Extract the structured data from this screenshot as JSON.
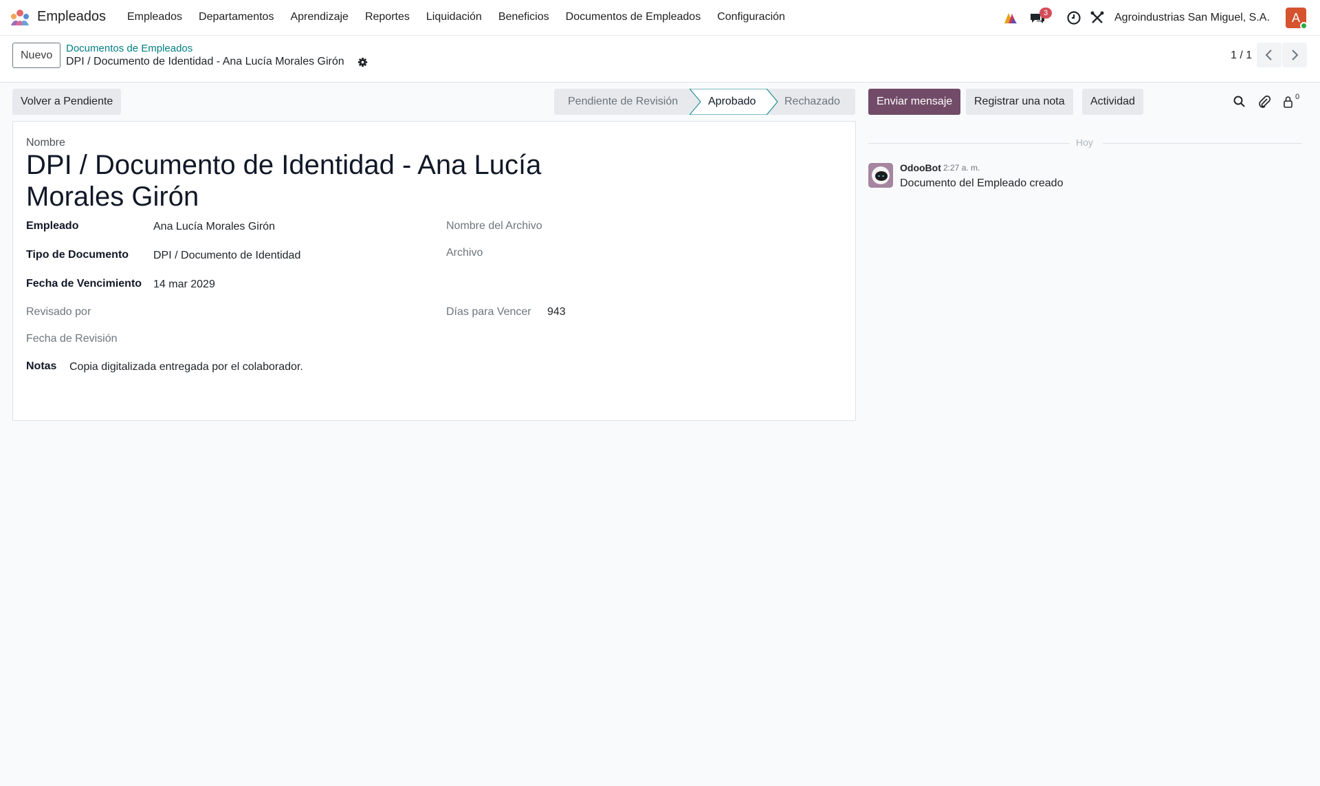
{
  "nav": {
    "app_name": "Empleados",
    "menu": [
      "Empleados",
      "Departamentos",
      "Aprendizaje",
      "Reportes",
      "Liquidación",
      "Beneficios",
      "Documentos de Empleados",
      "Configuración"
    ],
    "messages_badge": "3",
    "company": "Agroindustrias San Miguel, S.A.",
    "avatar_letter": "A",
    "icons": [
      "ai-icon",
      "chat-icon",
      "clock-icon",
      "tools-icon"
    ]
  },
  "control": {
    "new_label": "Nuevo",
    "breadcrumb_parent": "Documentos de Empleados",
    "breadcrumb_current": "DPI / Documento de Identidad - Ana Lucía Morales Girón",
    "pager": "1 / 1"
  },
  "actions": {
    "back_to_pending": "Volver a Pendiente",
    "stages": [
      "Pendiente de Revisión",
      "Aprobado",
      "Rechazado"
    ],
    "active_stage": "Aprobado"
  },
  "form": {
    "name_label": "Nombre",
    "title": "DPI / Documento de Identidad - Ana Lucía Morales Girón",
    "employee_label": "Empleado",
    "employee_value": "Ana Lucía Morales Girón",
    "doc_type_label": "Tipo de Documento",
    "doc_type_value": "DPI / Documento de Identidad",
    "expiry_label": "Fecha de Vencimiento",
    "expiry_value": "14 mar 2029",
    "reviewed_by_label": "Revisado por",
    "review_date_label": "Fecha de Revisión",
    "notes_label": "Notas",
    "notes_value": "Copia digitalizada entregada por el colaborador.",
    "file_name_label": "Nombre del Archivo",
    "file_label": "Archivo",
    "days_label": "Días para Vencer",
    "days_value": "943"
  },
  "chatter": {
    "send_message": "Enviar mensaje",
    "log_note": "Registrar una nota",
    "activity": "Actividad",
    "followers_count": "0",
    "date_separator": "Hoy",
    "message": {
      "author": "OdooBot",
      "time": "2:27 a. m.",
      "body": "Documento del Empleado creado"
    }
  },
  "colors": {
    "primary": "#714b67",
    "link": "#017e84",
    "badge": "#d44c59",
    "avatar": "#d5532f"
  }
}
